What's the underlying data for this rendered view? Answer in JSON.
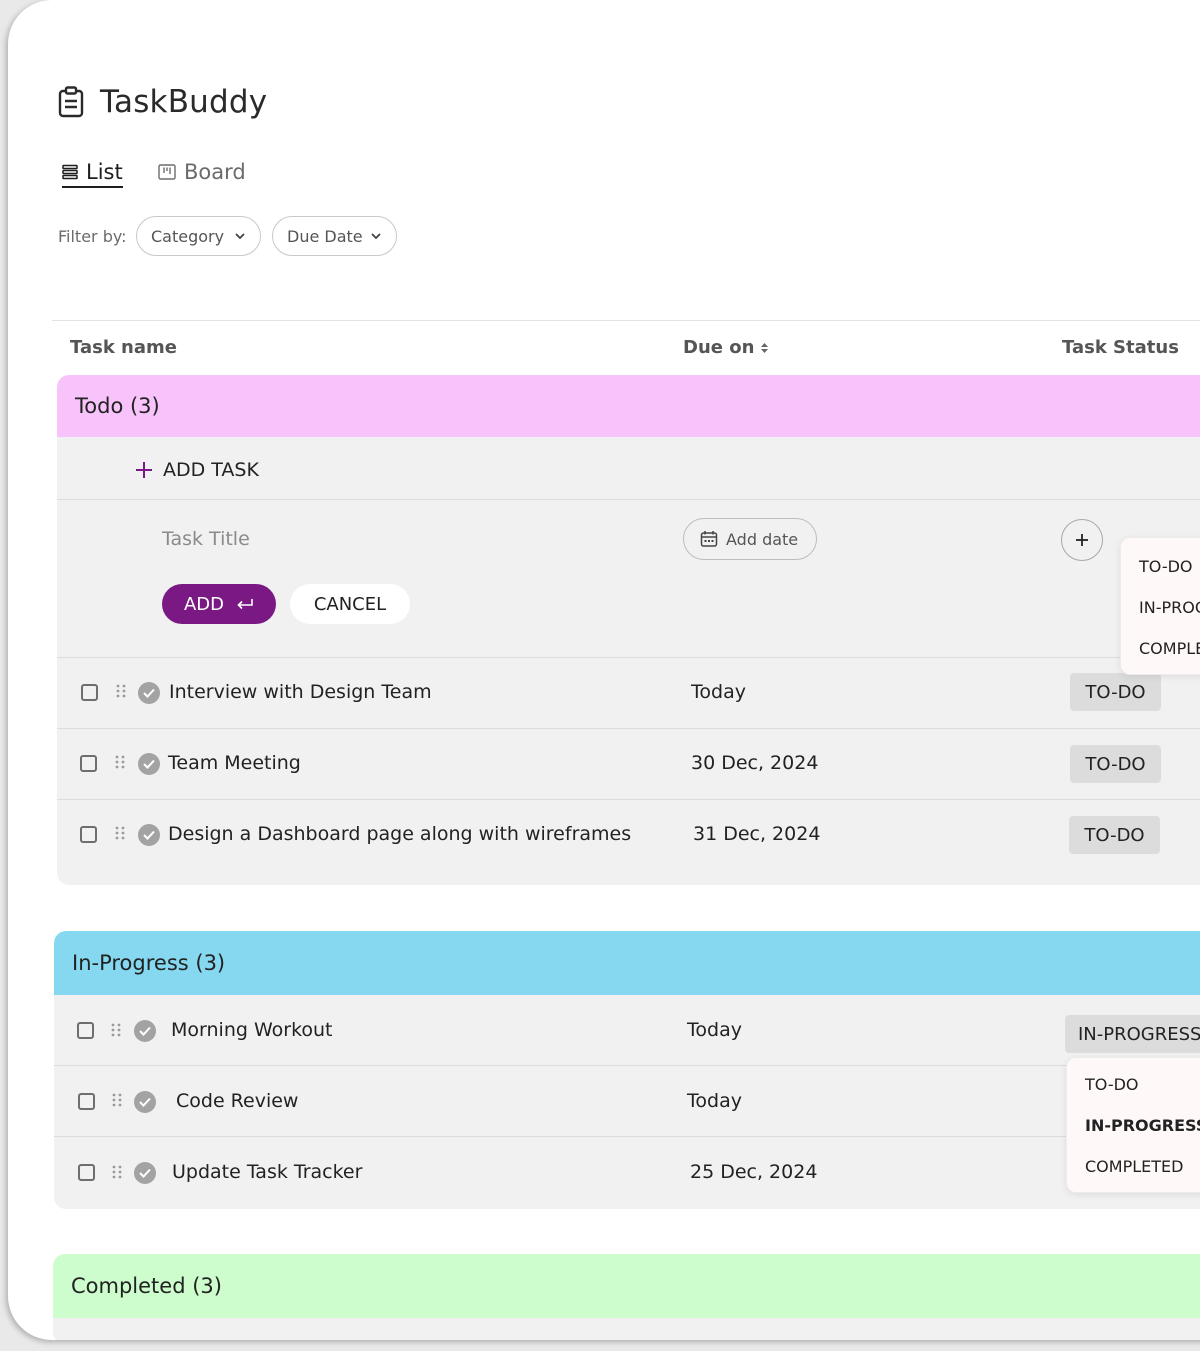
{
  "app": {
    "title": "TaskBuddy"
  },
  "tabs": [
    {
      "label": "List"
    },
    {
      "label": "Board"
    }
  ],
  "filters": {
    "label": "Filter by:",
    "category": "Category",
    "due_date": "Due Date"
  },
  "columns": {
    "name": "Task name",
    "due": "Due on",
    "status": "Task Status"
  },
  "colors": {
    "todo": "#f8c3fb",
    "in_progress": "#85d8ef",
    "completed": "#cdfdcc",
    "accent": "#7b1984"
  },
  "todo": {
    "title": "Todo (3)",
    "add_task": "ADD TASK",
    "form": {
      "title_placeholder": "Task Title",
      "add_date": "Add date",
      "add_button": "ADD",
      "cancel_button": "CANCEL",
      "status_options": [
        "TO-DO",
        "IN-PROG",
        "COMPLET"
      ]
    },
    "tasks": [
      {
        "name": "Interview with Design Team",
        "due": "Today",
        "status": "TO-DO"
      },
      {
        "name": "Team Meeting",
        "due": "30 Dec, 2024",
        "status": "TO-DO"
      },
      {
        "name": "Design a Dashboard page along with wireframes",
        "due": "31 Dec, 2024",
        "status": "TO-DO"
      }
    ]
  },
  "in_progress": {
    "title": "In-Progress (3)",
    "tasks": [
      {
        "name": "Morning Workout",
        "due": "Today",
        "status": "IN-PROGRESS"
      },
      {
        "name": "Code Review",
        "due": "Today"
      },
      {
        "name": "Update Task Tracker",
        "due": "25 Dec, 2024"
      }
    ],
    "status_menu": [
      "TO-DO",
      "IN-PROGRESS",
      "COMPLETED"
    ]
  },
  "completed": {
    "title": "Completed (3)"
  }
}
